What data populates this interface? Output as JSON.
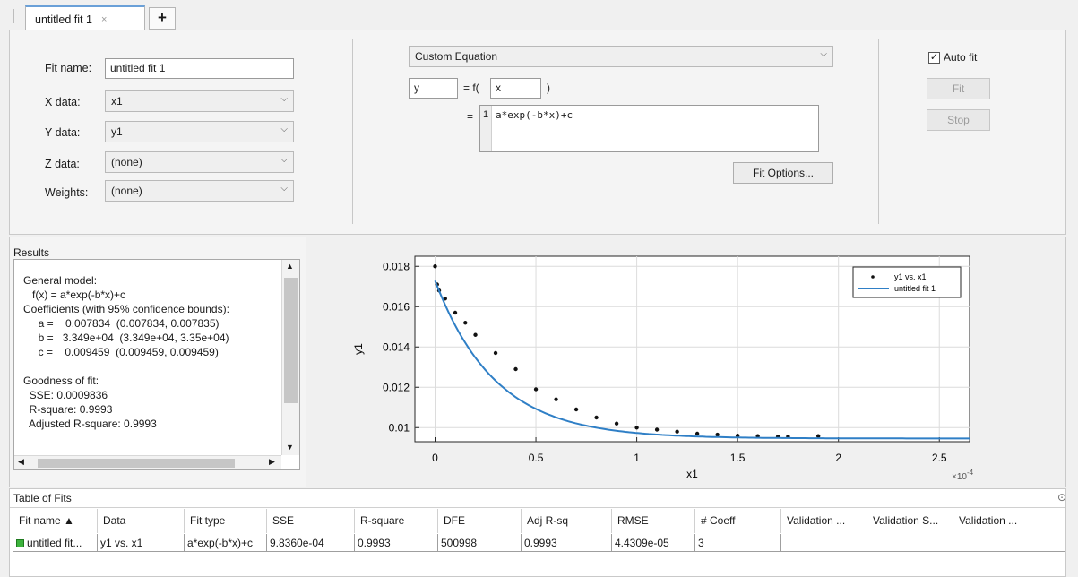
{
  "tab": {
    "name": "untitled fit 1",
    "close": "×",
    "add": "+"
  },
  "fields": {
    "fit_name_label": "Fit name:",
    "fit_name_value": "untitled fit 1",
    "x_label": "X data:",
    "x_value": "x1",
    "y_label": "Y data:",
    "y_value": "y1",
    "z_label": "Z data:",
    "z_value": "(none)",
    "w_label": "Weights:",
    "w_value": "(none)"
  },
  "equation": {
    "type": "Custom Equation",
    "dep_var": "y",
    "eq_f": "= f(",
    "indep_var": "x",
    "close_paren": ")",
    "equals": "=",
    "line_no": "1",
    "expression": "a*exp(-b*x)+c",
    "fit_options": "Fit Options..."
  },
  "controls": {
    "auto_fit": "Auto fit",
    "auto_fit_checked": true,
    "fit": "Fit",
    "stop": "Stop",
    "check_mark": "✓"
  },
  "results": {
    "title": "Results",
    "lines": [
      "General model:",
      "   f(x) = a*exp(-b*x)+c",
      "Coefficients (with 95% confidence bounds):",
      "     a =    0.007834  (0.007834, 0.007835)",
      "     b =   3.349e+04  (3.349e+04, 3.35e+04)",
      "     c =    0.009459  (0.009459, 0.009459)",
      "",
      "Goodness of fit:",
      "  SSE: 0.0009836",
      "  R-square: 0.9993",
      "  Adjusted R-square: 0.9993"
    ]
  },
  "chart_data": {
    "type": "scatter",
    "xlabel": "x1",
    "ylabel": "y1",
    "xlim": [
      -0.1,
      2.65
    ],
    "ylim": [
      0.0093,
      0.0185
    ],
    "x_scale_label": "×10",
    "x_scale_exp": "-4",
    "xticks": [
      0,
      0.5,
      1,
      1.5,
      2,
      2.5
    ],
    "xtick_labels": [
      "0",
      "0.5",
      "1",
      "1.5",
      "2",
      "2.5"
    ],
    "yticks": [
      0.01,
      0.012,
      0.014,
      0.016,
      0.018
    ],
    "ytick_labels": [
      "0.01",
      "0.012",
      "0.014",
      "0.016",
      "0.018"
    ],
    "grid": true,
    "legend_placement": "top-right",
    "legend": [
      "y1 vs. x1",
      "untitled fit 1"
    ],
    "model": {
      "a": 0.007834,
      "b": 3.349,
      "c": 0.009459
    },
    "series": [
      {
        "name": "y1 vs. x1",
        "kind": "points",
        "color": "#111111",
        "x": [
          0.0,
          0.01,
          0.02,
          0.05,
          0.1,
          0.15,
          0.2,
          0.3,
          0.4,
          0.5,
          0.6,
          0.7,
          0.8,
          0.9,
          1.0,
          1.1,
          1.2,
          1.3,
          1.4,
          1.5,
          1.6,
          1.7,
          1.75,
          1.9
        ],
        "y": [
          0.018,
          0.0171,
          0.0168,
          0.0164,
          0.0157,
          0.0152,
          0.0146,
          0.0137,
          0.0129,
          0.0119,
          0.0114,
          0.0109,
          0.0105,
          0.0102,
          0.01,
          0.0099,
          0.0098,
          0.0097,
          0.00965,
          0.0096,
          0.00958,
          0.00956,
          0.00956,
          0.00958
        ]
      },
      {
        "name": "untitled fit 1",
        "kind": "line",
        "color": "#2f7fc6"
      }
    ]
  },
  "table": {
    "title": "Table of Fits",
    "columns": [
      "Fit name ▲",
      "Data",
      "Fit type",
      "SSE",
      "R-square",
      "DFE",
      "Adj R-sq",
      "RMSE",
      "# Coeff",
      "Validation ...",
      "Validation S...",
      "Validation ..."
    ],
    "rows": [
      [
        "untitled fit...",
        "y1 vs. x1",
        "a*exp(-b*x)+c",
        "9.8360e-04",
        "0.9993",
        "500998",
        "0.9993",
        "4.4309e-05",
        "3",
        "",
        "",
        ""
      ]
    ],
    "status_color": "#3db33d",
    "collapse_glyph": "⊙"
  }
}
